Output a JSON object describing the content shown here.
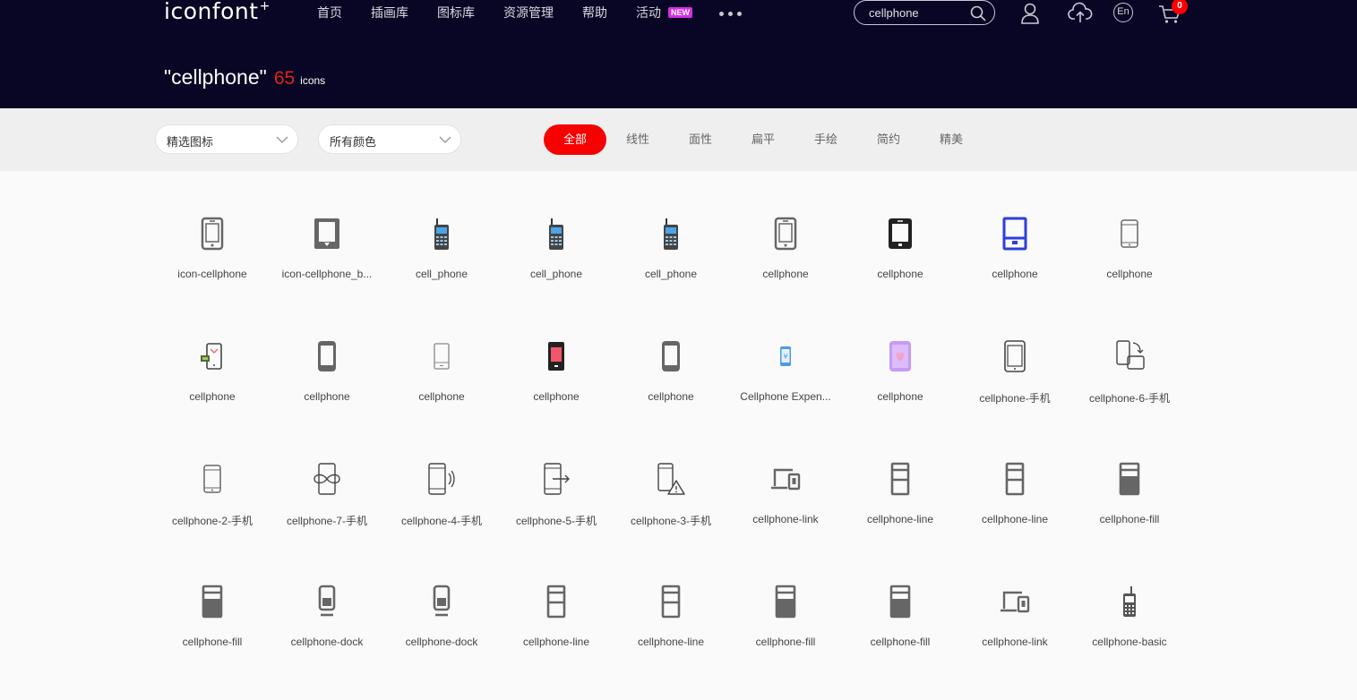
{
  "header": {
    "logo": "iconfont",
    "nav": [
      "首页",
      "插画库",
      "图标库",
      "资源管理",
      "帮助",
      "活动"
    ],
    "new_badge": "NEW",
    "search_value": "cellphone",
    "lang_label": "En",
    "cart_count": "0"
  },
  "result": {
    "query": "\"cellphone\"",
    "count": "65",
    "unit": "icons"
  },
  "filters": {
    "select_icons": "精选图标",
    "select_colors": "所有颜色",
    "tabs": [
      "全部",
      "线性",
      "面性",
      "扁平",
      "手绘",
      "简约",
      "精美"
    ],
    "active_tab": "全部"
  },
  "colors": {
    "header_bg": "#080624",
    "accent_red": "#f70000",
    "icon_gray": "#666666"
  },
  "icons": [
    {
      "name": "icon-cellphone",
      "glyph": "phone-outline-icon"
    },
    {
      "name": "icon-cellphone_b...",
      "glyph": "phone-bold-outline-icon"
    },
    {
      "name": "cell_phone",
      "glyph": "retro-cellphone-icon"
    },
    {
      "name": "cell_phone",
      "glyph": "retro-cellphone-icon"
    },
    {
      "name": "cell_phone",
      "glyph": "retro-cellphone-icon"
    },
    {
      "name": "cellphone",
      "glyph": "phone-outline-icon"
    },
    {
      "name": "cellphone",
      "glyph": "phone-black-icon"
    },
    {
      "name": "cellphone",
      "glyph": "phone-blue-icon"
    },
    {
      "name": "cellphone",
      "glyph": "phone-thin-icon"
    },
    {
      "name": "cellphone",
      "glyph": "phone-payment-icon"
    },
    {
      "name": "cellphone",
      "glyph": "phone-rounded-icon"
    },
    {
      "name": "cellphone",
      "glyph": "phone-light-icon"
    },
    {
      "name": "cellphone",
      "glyph": "phone-red-screen-icon"
    },
    {
      "name": "cellphone",
      "glyph": "phone-rounded-icon"
    },
    {
      "name": "Cellphone Expen...",
      "glyph": "phone-yuan-icon"
    },
    {
      "name": "cellphone",
      "glyph": "phone-purple-heart-icon"
    },
    {
      "name": "cellphone-手机",
      "glyph": "tablet-outline-icon"
    },
    {
      "name": "cellphone-6-手机",
      "glyph": "phone-rotate-icon"
    },
    {
      "name": "cellphone-2-手机",
      "glyph": "phone-thin-icon"
    },
    {
      "name": "cellphone-7-手机",
      "glyph": "phone-infinity-icon"
    },
    {
      "name": "cellphone-4-手机",
      "glyph": "phone-vibrate-icon"
    },
    {
      "name": "cellphone-5-手机",
      "glyph": "phone-export-icon"
    },
    {
      "name": "cellphone-3-手机",
      "glyph": "phone-warning-icon"
    },
    {
      "name": "cellphone-link",
      "glyph": "phone-link-icon"
    },
    {
      "name": "cellphone-line",
      "glyph": "phone-line-icon"
    },
    {
      "name": "cellphone-line",
      "glyph": "phone-line-icon"
    },
    {
      "name": "cellphone-fill",
      "glyph": "phone-fill-icon"
    },
    {
      "name": "cellphone-fill",
      "glyph": "phone-fill-icon"
    },
    {
      "name": "cellphone-dock",
      "glyph": "phone-dock-icon"
    },
    {
      "name": "cellphone-dock",
      "glyph": "phone-dock-icon"
    },
    {
      "name": "cellphone-line",
      "glyph": "phone-line-icon"
    },
    {
      "name": "cellphone-line",
      "glyph": "phone-line-icon"
    },
    {
      "name": "cellphone-fill",
      "glyph": "phone-fill-icon"
    },
    {
      "name": "cellphone-fill",
      "glyph": "phone-fill-icon"
    },
    {
      "name": "cellphone-link",
      "glyph": "phone-link-icon"
    },
    {
      "name": "cellphone-basic",
      "glyph": "phone-basic-icon"
    }
  ]
}
